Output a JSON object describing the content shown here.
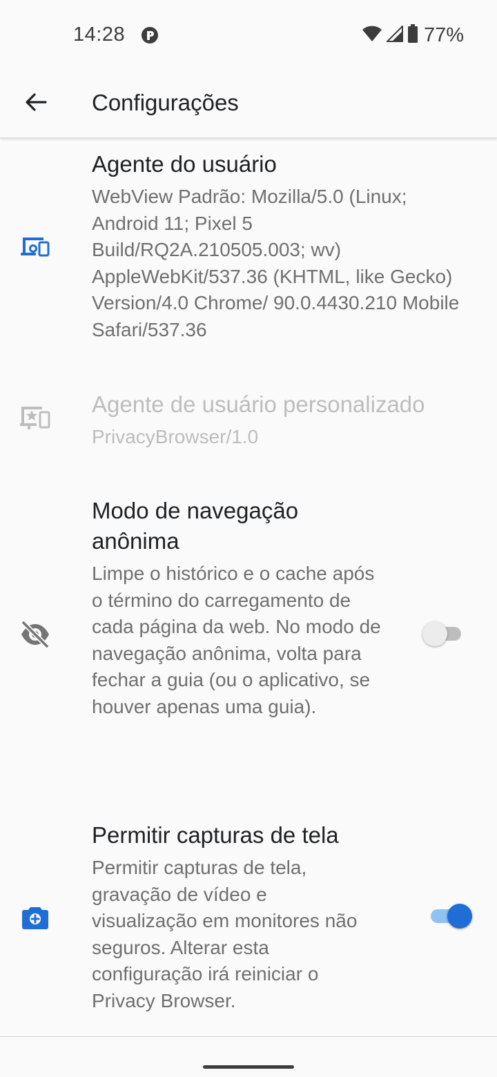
{
  "status_bar": {
    "time": "14:28",
    "battery": "77%",
    "icons": [
      "data-saver-icon",
      "wifi-icon",
      "cell-signal-icon",
      "battery-icon"
    ]
  },
  "app_bar": {
    "title": "Configurações",
    "back_icon": "arrow-back-icon"
  },
  "preferences": [
    {
      "icon": "devices-icon",
      "title": "Agente do usuário",
      "summary": "WebView Padrão: Mozilla/5.0 (Linux; Android 11; Pixel 5 Build/RQ2A.210505.003; wv) AppleWebKit/537.36 (KHTML, like Gecko) Version/4.0 Chrome/ 90.0.4430.210 Mobile Safari/537.36",
      "enabled": true
    },
    {
      "icon": "custom-devices-icon",
      "title": "Agente de usuário personalizado",
      "summary": "PrivacyBrowser/1.0",
      "enabled": false
    },
    {
      "icon": "visibility-off-icon",
      "title": "Modo de navegação anônima",
      "summary": "Limpe o histórico e o cache após o término do carregamento de cada página da web. No modo de navegação anônima, volta para fechar a guia (ou o aplicativo, se houver apenas uma guia).",
      "switch_on": false,
      "enabled": true
    },
    {
      "icon": "camera-icon",
      "title": "Permitir capturas de tela",
      "summary": "Permitir capturas de tela, gravação de vídeo e visualização em monitores não seguros. Alterar esta configuração irá reiniciar o Privacy Browser.",
      "switch_on": true,
      "enabled": true
    }
  ],
  "colors": {
    "accent": "#1e6ed6",
    "accent_track": "#90c2f2",
    "title_text": "#202124",
    "summary_text": "#6f6f6f",
    "disabled_text": "#bdbdbd",
    "background": "#fafafa"
  }
}
